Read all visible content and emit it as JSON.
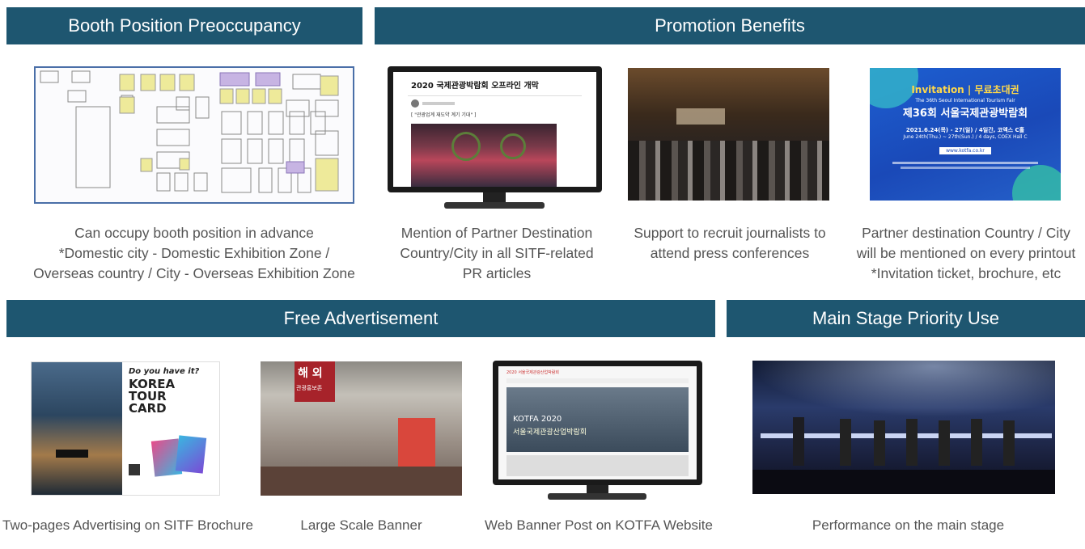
{
  "sections": {
    "booth": {
      "title": "Booth Position Preoccupancy"
    },
    "promotion": {
      "title": "Promotion Benefits"
    },
    "advertisement": {
      "title": "Free Advertisement"
    },
    "stage": {
      "title": "Main Stage Priority Use"
    }
  },
  "captions": {
    "booth": [
      "Can occupy booth position in advance",
      "*Domestic city - Domestic Exhibition Zone /",
      "Overseas country / City - Overseas Exhibition Zone"
    ],
    "mention": [
      "Mention of Partner Destination",
      "Country/City in all SITF-related",
      "PR articles"
    ],
    "journalists": [
      "Support to recruit journalists to",
      "attend press conferences"
    ],
    "printout": [
      "Partner destination Country / City",
      "will be mentioned on every printout",
      "*Invitation ticket, brochure, etc"
    ],
    "brochure": [
      "Two-pages Advertising on SITF Brochure"
    ],
    "banner": [
      "Large Scale Banner"
    ],
    "web": [
      "Web Banner Post on KOTFA Website"
    ],
    "performance": [
      "Performance on the main stage"
    ]
  },
  "images": {
    "article_title": "2020 국제관광박람회 오프라인 개막",
    "article_sub": "[ \"관광업계 재도약 계기 기대\" ]",
    "invite_header": "Invitation | 무료초대권",
    "invite_sub": "The 36th Seoul International Tourism Fair",
    "invite_title": "제36회 서울국제관광박람회",
    "invite_date": "2021.6.24(목) - 27(일) / 4일간, 코엑스 C홀",
    "invite_date_en": "June 24th(Thu.) ~ 27th(Sun.) / 4 days, COEX Hall C",
    "invite_url": "www.kotfa.co.kr",
    "brochure_q": "Do you have it?",
    "brochure_card": [
      "KOREA",
      "TOUR",
      "CARD"
    ],
    "banner_sign": "해 외",
    "banner_sub": "관광홍보존",
    "web_logo": "2020 서울국제관광산업박람회",
    "web_banner": "KOTFA 2020",
    "web_banner_sub": "서울국제관광산업박람회"
  },
  "colors": {
    "bar": "#1e5670",
    "caption": "#555555"
  }
}
